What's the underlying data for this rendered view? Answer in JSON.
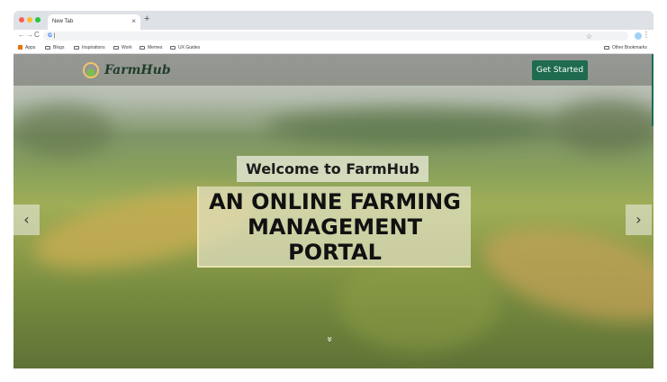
{
  "browser": {
    "tab_title": "New Tab",
    "tab_close": "×",
    "new_tab": "+",
    "back": "←",
    "forward": "→",
    "reload": "C",
    "omnibox_icon": "G",
    "omnibox_value": "",
    "star": "☆",
    "menu": "⋮",
    "bookmarks": [
      {
        "label": "Apps",
        "icon": "apps-icon"
      },
      {
        "label": "Blogs",
        "icon": "folder-icon"
      },
      {
        "label": "Inspirations",
        "icon": "folder-icon"
      },
      {
        "label": "Work",
        "icon": "folder-icon"
      },
      {
        "label": "Memes",
        "icon": "folder-icon"
      },
      {
        "label": "UX Guides",
        "icon": "folder-icon"
      }
    ],
    "other_bookmarks": "Other Bookmarks"
  },
  "site": {
    "brand": "FarmHub",
    "cta_label": "Get Started",
    "welcome": "Welcome to FarmHub",
    "headline": "AN ONLINE FARMING MANAGEMENT PORTAL",
    "prev_arrow": "‹",
    "next_arrow": "›",
    "scroll_hint": "»"
  }
}
